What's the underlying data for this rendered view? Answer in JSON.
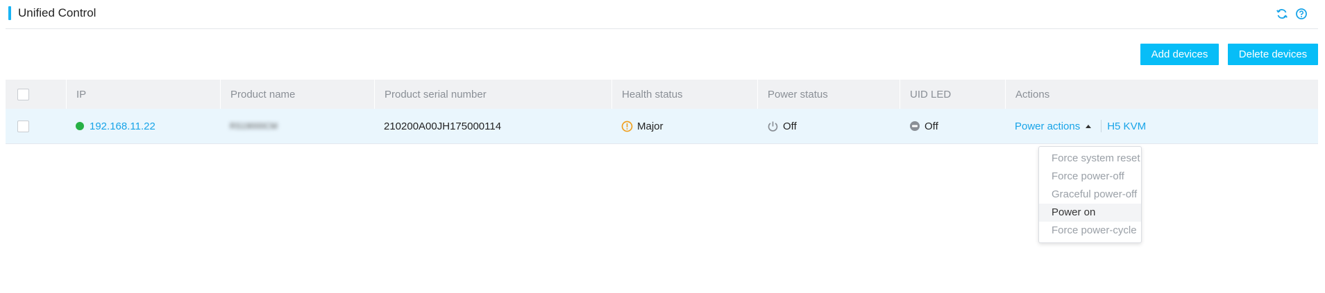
{
  "header": {
    "title": "Unified Control",
    "accent_color": "#18b4f5",
    "icons": [
      "refresh-icon",
      "help-icon"
    ]
  },
  "toolbar": {
    "add_label": "Add devices",
    "delete_label": "Delete devices",
    "button_color": "#07bdf7"
  },
  "table": {
    "columns": [
      "IP",
      "Product name",
      "Product serial number",
      "Health status",
      "Power status",
      "UID LED",
      "Actions"
    ],
    "rows": [
      {
        "ip": "192.168.11.22",
        "ip_status_color": "#27b045",
        "product_name": "RS19000CM",
        "serial": "210200A00JH175000114",
        "health": "Major",
        "health_color": "#f0a020",
        "power": "Off",
        "uid_led": "Off",
        "power_actions_label": "Power actions",
        "kvm_label": "H5 KVM"
      }
    ]
  },
  "power_menu": {
    "items": [
      {
        "label": "Force system reset",
        "enabled": false
      },
      {
        "label": "Force power-off",
        "enabled": false
      },
      {
        "label": "Graceful power-off",
        "enabled": false
      },
      {
        "label": "Power on",
        "enabled": true
      },
      {
        "label": "Force power-cycle",
        "enabled": false
      }
    ]
  }
}
